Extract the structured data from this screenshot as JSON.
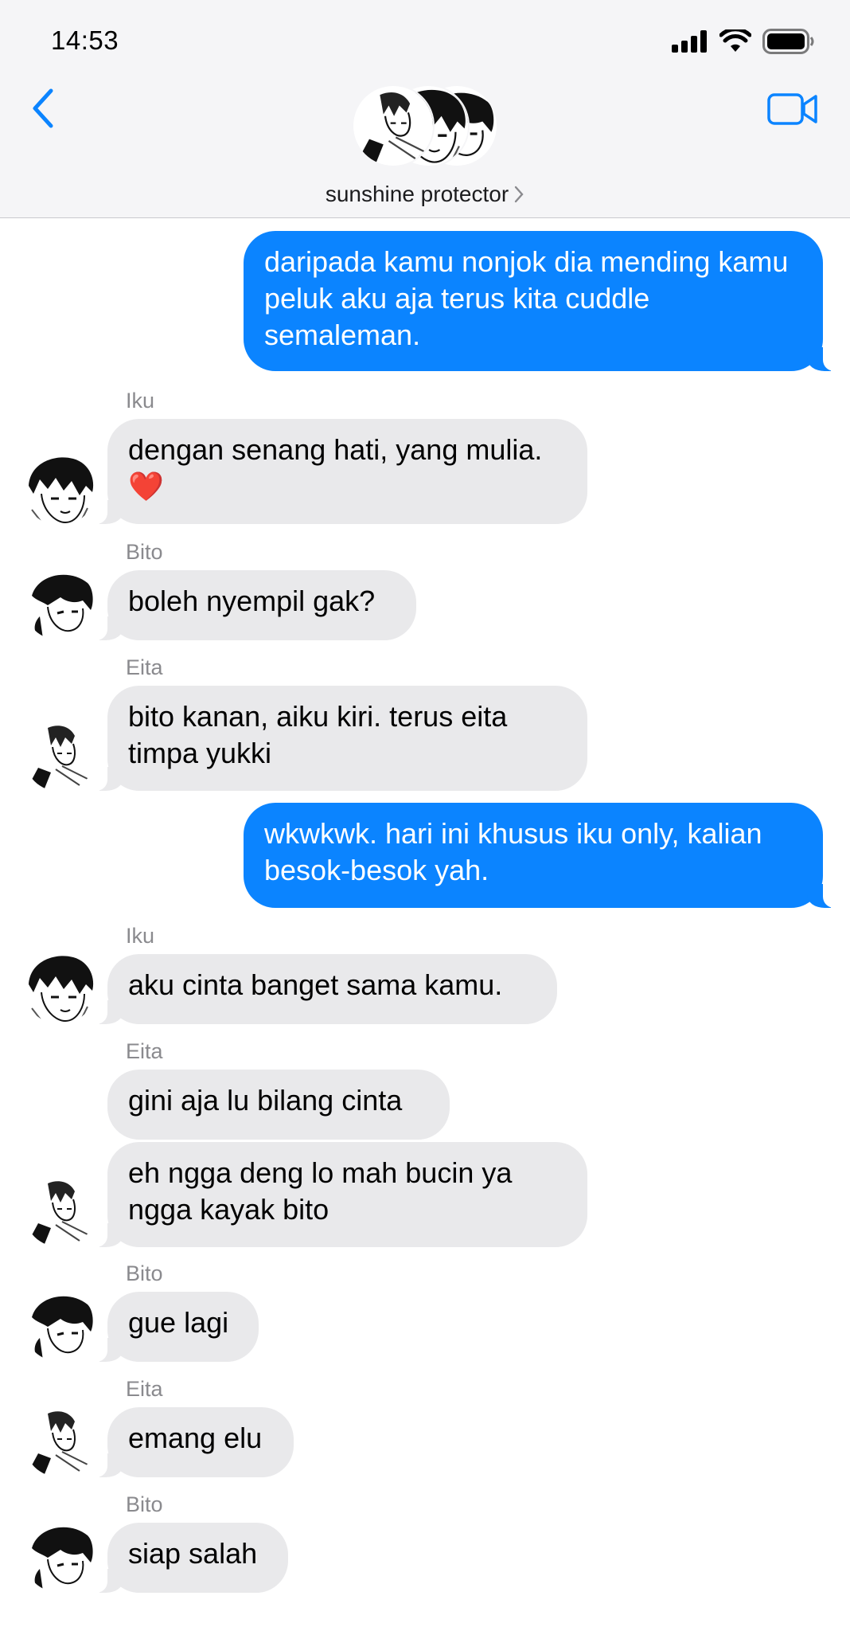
{
  "status_bar": {
    "time": "14:53"
  },
  "header": {
    "group_name": "sunshine protector"
  },
  "messages": [
    {
      "sender": "",
      "text": "daripada kamu nonjok dia mending kamu peluk aku aja terus kita cuddle semaleman."
    },
    {
      "sender": "Iku",
      "text": "dengan senang hati, yang mulia.",
      "emoji": "❤️"
    },
    {
      "sender": "Bito",
      "text": "boleh nyempil gak?"
    },
    {
      "sender": "Eita",
      "text": "bito kanan, aiku kiri. terus eita timpa yukki"
    },
    {
      "sender": "",
      "text": "wkwkwk. hari ini khusus iku only, kalian besok-besok yah."
    },
    {
      "sender": "Iku",
      "text": "aku cinta banget sama kamu."
    },
    {
      "sender": "Eita",
      "text": "gini aja lu bilang cinta"
    },
    {
      "sender": "",
      "text": "eh ngga deng lo mah bucin ya ngga kayak bito"
    },
    {
      "sender": "Bito",
      "text": "gue lagi"
    },
    {
      "sender": "Eita",
      "text": "emang elu"
    },
    {
      "sender": "Bito",
      "text": "siap salah"
    }
  ],
  "icons": {
    "back": "chevron-left-icon",
    "video": "video-camera-icon",
    "signal": "cellular-signal-icon",
    "wifi": "wifi-icon",
    "battery": "battery-icon"
  },
  "colors": {
    "accent": "#0b84ff",
    "incoming_bubble": "#e9e9eb",
    "outgoing_bubble": "#0b84ff"
  }
}
